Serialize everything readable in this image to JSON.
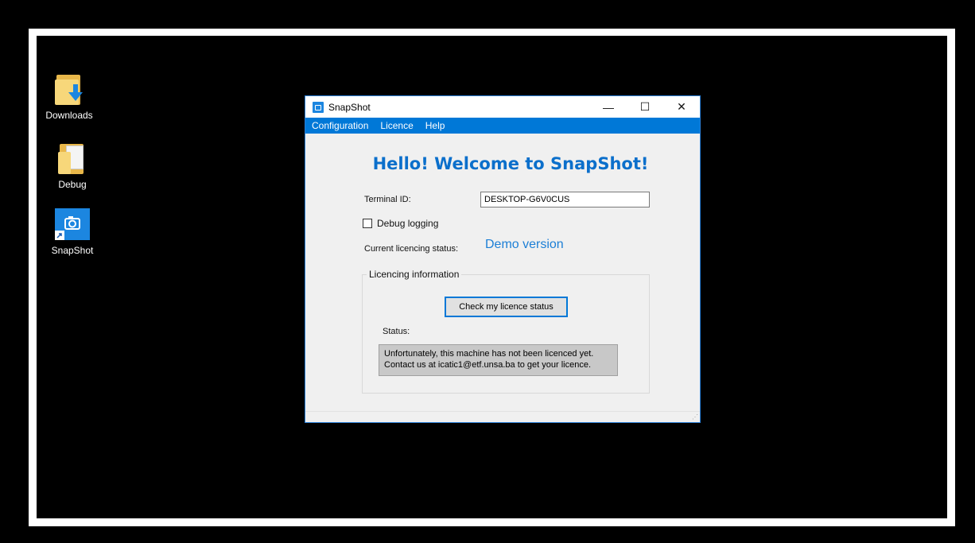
{
  "desktop": {
    "icons": [
      {
        "label": "Downloads",
        "icon": "folder-download-icon"
      },
      {
        "label": "Debug",
        "icon": "folder-icon"
      },
      {
        "label": "SnapShot",
        "icon": "camera-app-icon"
      }
    ]
  },
  "window": {
    "title": "SnapShot",
    "controls": {
      "minimize": "—",
      "maximize": "☐",
      "close": "✕"
    },
    "menu": [
      "Configuration",
      "Licence",
      "Help"
    ],
    "heading": "Hello! Welcome to SnapShot!",
    "terminal": {
      "label": "Terminal ID:",
      "value": "DESKTOP-G6V0CUS"
    },
    "debug": {
      "label": "Debug logging",
      "checked": false
    },
    "licencing_status": {
      "label": "Current licencing status:",
      "value": "Demo version"
    },
    "licence_group": {
      "legend": "Licencing information",
      "check_button": "Check my licence status",
      "status_label": "Status:",
      "status_line1": "Unfortunately, this machine has not been licenced yet.",
      "status_line2": "Contact us at icatic1@etf.unsa.ba to get your licence."
    }
  },
  "colors": {
    "accent": "#0078d7",
    "heading": "#0b6fcb",
    "demo": "#1c7fd6"
  }
}
